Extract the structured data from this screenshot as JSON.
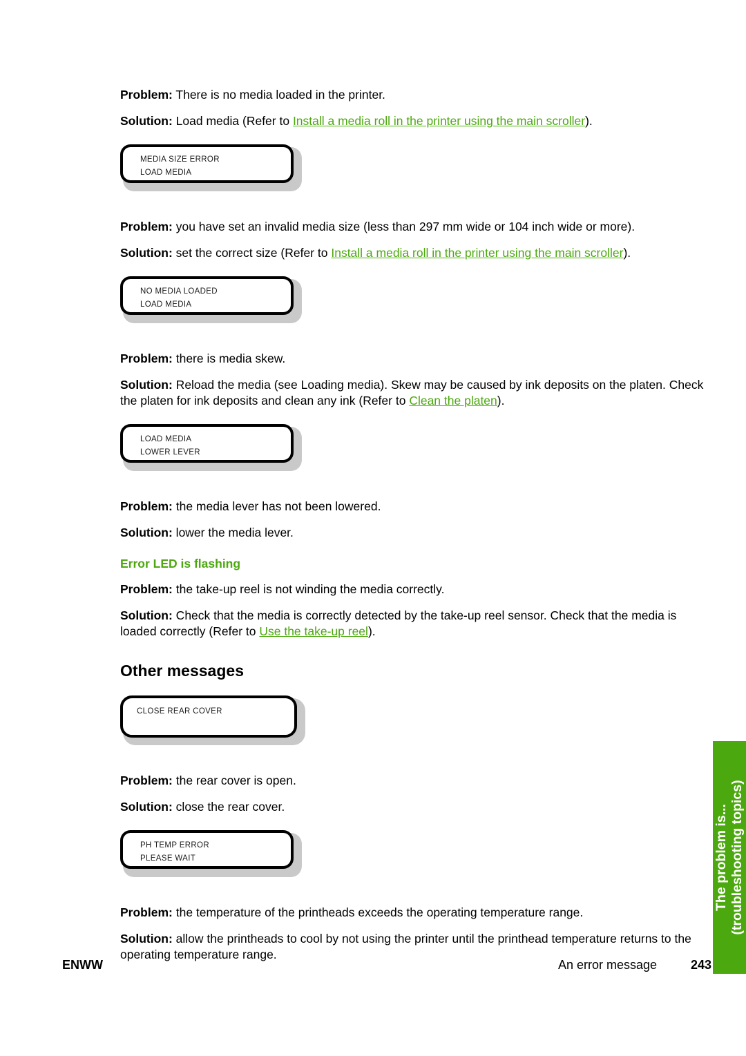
{
  "document": {
    "page_number": "243",
    "footer_left": "ENWW",
    "footer_section": "An error message"
  },
  "side_tab": {
    "line1": "The problem is...",
    "line2": "(troubleshooting topics)",
    "color": "#4CA80F"
  },
  "colors": {
    "link": "#4CA80F",
    "heading_green": "#4CA80F",
    "lcd_frame": "#c9c9c9",
    "text": "#000000"
  },
  "blocks": [
    {
      "problem_label": "Problem:",
      "problem_text": " There is no media loaded in the printer.",
      "solution_label": "Solution:",
      "solution_pre": " Load media (Refer to ",
      "solution_link": "Install a media roll in the printer using the main scroller",
      "solution_post": ").",
      "lcd_line1": "MEDIA SIZE ERROR",
      "lcd_line2": "LOAD MEDIA"
    },
    {
      "problem_label": "Problem:",
      "problem_text": " you have set an invalid media size (less than 297 mm wide or 104 inch wide or more).",
      "solution_label": "Solution:",
      "solution_pre": " set the correct size (Refer to ",
      "solution_link": "Install a media roll in the printer using the main scroller",
      "solution_post": ").",
      "lcd_line1": "NO MEDIA LOADED",
      "lcd_line2": "LOAD MEDIA"
    },
    {
      "problem_label": "Problem:",
      "problem_text": " there is media skew.",
      "solution_label": "Solution:",
      "solution_pre": " Reload the media (see Loading media). Skew may be caused by ink deposits on the platen. Check the platen for ink deposits and clean any ink (Refer to ",
      "solution_link": "Clean the platen",
      "solution_post": ").",
      "lcd_line1": "LOAD MEDIA",
      "lcd_line2": "LOWER LEVER"
    },
    {
      "problem_label": "Problem:",
      "problem_text": " the media lever has not been lowered.",
      "solution_label": "Solution:",
      "solution_pre": " lower the media lever.",
      "solution_link": "",
      "solution_post": ""
    }
  ],
  "error_led_section": {
    "heading": "Error LED is flashing",
    "problem_label": "Problem:",
    "problem_text": " the take-up reel is not winding the media correctly.",
    "solution_label": "Solution:",
    "solution_pre": " Check that the media is correctly detected by the take-up reel sensor. Check that the media is loaded correctly (Refer to ",
    "solution_link": "Use the take-up reel",
    "solution_post": ")."
  },
  "other_messages": {
    "heading": "Other messages",
    "blocks": [
      {
        "lcd_line1": "CLOSE REAR COVER",
        "lcd_line2": "",
        "problem_label": "Problem:",
        "problem_text": " the rear cover is open.",
        "solution_label": "Solution:",
        "solution_pre": " close the rear cover.",
        "solution_link": "",
        "solution_post": ""
      },
      {
        "lcd_line1": "PH TEMP ERROR",
        "lcd_line2": "PLEASE WAIT",
        "problem_label": "Problem:",
        "problem_text": " the temperature of the printheads exceeds the operating temperature range.",
        "solution_label": "Solution:",
        "solution_pre": " allow the printheads to cool by not using the printer until the printhead temperature returns to the operating temperature range.",
        "solution_link": "",
        "solution_post": ""
      }
    ]
  }
}
